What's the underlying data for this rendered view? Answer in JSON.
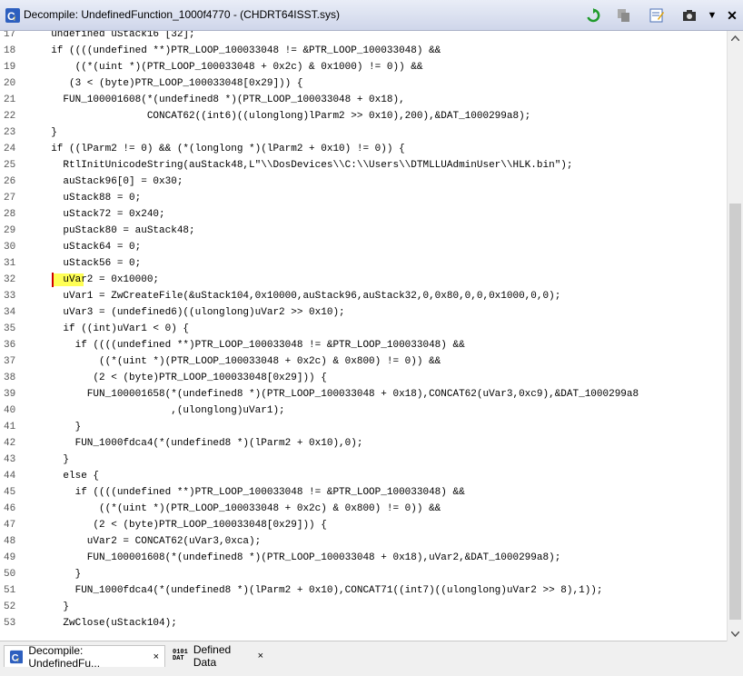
{
  "window": {
    "title": "Decompile: UndefinedFunction_1000f4770 -  (CHDRT64ISST.sys)"
  },
  "toolbar": {
    "buttons": [
      "refresh-icon",
      "copy-icon",
      "edit-icon",
      "snapshot-icon",
      "menu-dropdown-icon",
      "close-icon"
    ],
    "close_glyph": "✕",
    "dropdown_glyph": "▼"
  },
  "code": {
    "lines": [
      {
        "num": "17",
        "text": "  undefined uStack16 [32];"
      },
      {
        "num": "18",
        "text": "  if ((((undefined **)PTR_LOOP_100033048 != &PTR_LOOP_100033048) &&"
      },
      {
        "num": "19",
        "text": "      ((*(uint *)(PTR_LOOP_100033048 + 0x2c) & 0x1000) != 0)) &&"
      },
      {
        "num": "20",
        "text": "     (3 < (byte)PTR_LOOP_100033048[0x29])) {"
      },
      {
        "num": "21",
        "text": "    FUN_100001608(*(undefined8 *)(PTR_LOOP_100033048 + 0x18),"
      },
      {
        "num": "22",
        "text": "                  CONCAT62((int6)((ulonglong)lParm2 >> 0x10),200),&DAT_1000299a8);"
      },
      {
        "num": "23",
        "text": "  }"
      },
      {
        "num": "24",
        "text": "  if ((lParm2 != 0) && (*(longlong *)(lParm2 + 0x10) != 0)) {"
      },
      {
        "num": "25",
        "text": "    RtlInitUnicodeString(auStack48,L\"\\\\DosDevices\\\\C:\\\\Users\\\\DTMLLUAdminUser\\\\HLK.bin\");"
      },
      {
        "num": "26",
        "text": "    auStack96[0] = 0x30;"
      },
      {
        "num": "27",
        "text": "    uStack88 = 0;"
      },
      {
        "num": "28",
        "text": "    uStack72 = 0x240;"
      },
      {
        "num": "29",
        "text": "    puStack80 = auStack48;"
      },
      {
        "num": "30",
        "text": "    uStack64 = 0;"
      },
      {
        "num": "31",
        "text": "    uStack56 = 0;"
      },
      {
        "num": "32",
        "text": "    uVar2 = 0x10000;"
      },
      {
        "num": "33",
        "text": "    uVar1 = ZwCreateFile(&uStack104,0x10000,auStack96,auStack32,0,0x80,0,0,0x1000,0,0);"
      },
      {
        "num": "34",
        "text": "    uVar3 = (undefined6)((ulonglong)uVar2 >> 0x10);"
      },
      {
        "num": "35",
        "text": "    if ((int)uVar1 < 0) {"
      },
      {
        "num": "36",
        "text": "      if ((((undefined **)PTR_LOOP_100033048 != &PTR_LOOP_100033048) &&"
      },
      {
        "num": "37",
        "text": "          ((*(uint *)(PTR_LOOP_100033048 + 0x2c) & 0x800) != 0)) &&"
      },
      {
        "num": "38",
        "text": "         (2 < (byte)PTR_LOOP_100033048[0x29])) {"
      },
      {
        "num": "39",
        "text": "        FUN_100001658(*(undefined8 *)(PTR_LOOP_100033048 + 0x18),CONCAT62(uVar3,0xc9),&DAT_1000299a8"
      },
      {
        "num": "40",
        "text": "                      ,(ulonglong)uVar1);"
      },
      {
        "num": "41",
        "text": "      }"
      },
      {
        "num": "42",
        "text": "      FUN_1000fdca4(*(undefined8 *)(lParm2 + 0x10),0);"
      },
      {
        "num": "43",
        "text": "    }"
      },
      {
        "num": "44",
        "text": "    else {"
      },
      {
        "num": "45",
        "text": "      if ((((undefined **)PTR_LOOP_100033048 != &PTR_LOOP_100033048) &&"
      },
      {
        "num": "46",
        "text": "          ((*(uint *)(PTR_LOOP_100033048 + 0x2c) & 0x800) != 0)) &&"
      },
      {
        "num": "47",
        "text": "         (2 < (byte)PTR_LOOP_100033048[0x29])) {"
      },
      {
        "num": "48",
        "text": "        uVar2 = CONCAT62(uVar3,0xca);"
      },
      {
        "num": "49",
        "text": "        FUN_100001608(*(undefined8 *)(PTR_LOOP_100033048 + 0x18),uVar2,&DAT_1000299a8);"
      },
      {
        "num": "50",
        "text": "      }"
      },
      {
        "num": "51",
        "text": "      FUN_1000fdca4(*(undefined8 *)(lParm2 + 0x10),CONCAT71((int7)((ulonglong)uVar2 >> 8),1));"
      },
      {
        "num": "52",
        "text": "    }"
      },
      {
        "num": "53",
        "text": "    ZwClose(uStack104);"
      }
    ]
  },
  "tabs": [
    {
      "label": "Decompile: UndefinedFu...",
      "close": "×",
      "icon": "decompile-icon"
    },
    {
      "label": "Defined Data",
      "close": "×",
      "icon_text_top": "0101",
      "icon_text_bottom": "DAT"
    }
  ]
}
